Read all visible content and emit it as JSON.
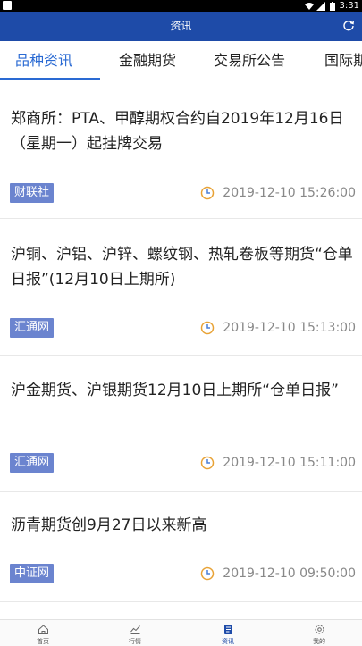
{
  "status_bar": {
    "time": "3:31"
  },
  "header": {
    "title": "资讯"
  },
  "tabs": [
    {
      "label": "品种资讯",
      "active": true
    },
    {
      "label": "金融期货",
      "active": false
    },
    {
      "label": "交易所公告",
      "active": false
    },
    {
      "label": "国际期",
      "active": false
    }
  ],
  "news": [
    {
      "title": "郑商所：PTA、甲醇期权合约自2019年12月16日（星期一）起挂牌交易",
      "source": "财联社",
      "time": "2019-12-10 15:26:00"
    },
    {
      "title": "沪铜、沪铝、沪锌、螺纹钢、热轧卷板等期货“仓单日报”(12月10日上期所)",
      "source": "汇通网",
      "time": "2019-12-10 15:13:00"
    },
    {
      "title": "沪金期货、沪银期货12月10日上期所“仓单日报”",
      "source": "汇通网",
      "time": "2019-12-10 15:11:00"
    },
    {
      "title": "沥青期货创9月27日以来新高",
      "source": "中证网",
      "time": "2019-12-10 09:50:00"
    }
  ],
  "bottom_nav": [
    {
      "label": "首页",
      "icon": "home-icon"
    },
    {
      "label": "行情",
      "icon": "chart-icon"
    },
    {
      "label": "资讯",
      "icon": "news-icon",
      "active": true
    },
    {
      "label": "我的",
      "icon": "settings-icon"
    }
  ],
  "colors": {
    "primary": "#1e4ba8",
    "tab_active": "#2a6ad3",
    "badge": "#6b84cf",
    "clock": "#e8a235"
  }
}
